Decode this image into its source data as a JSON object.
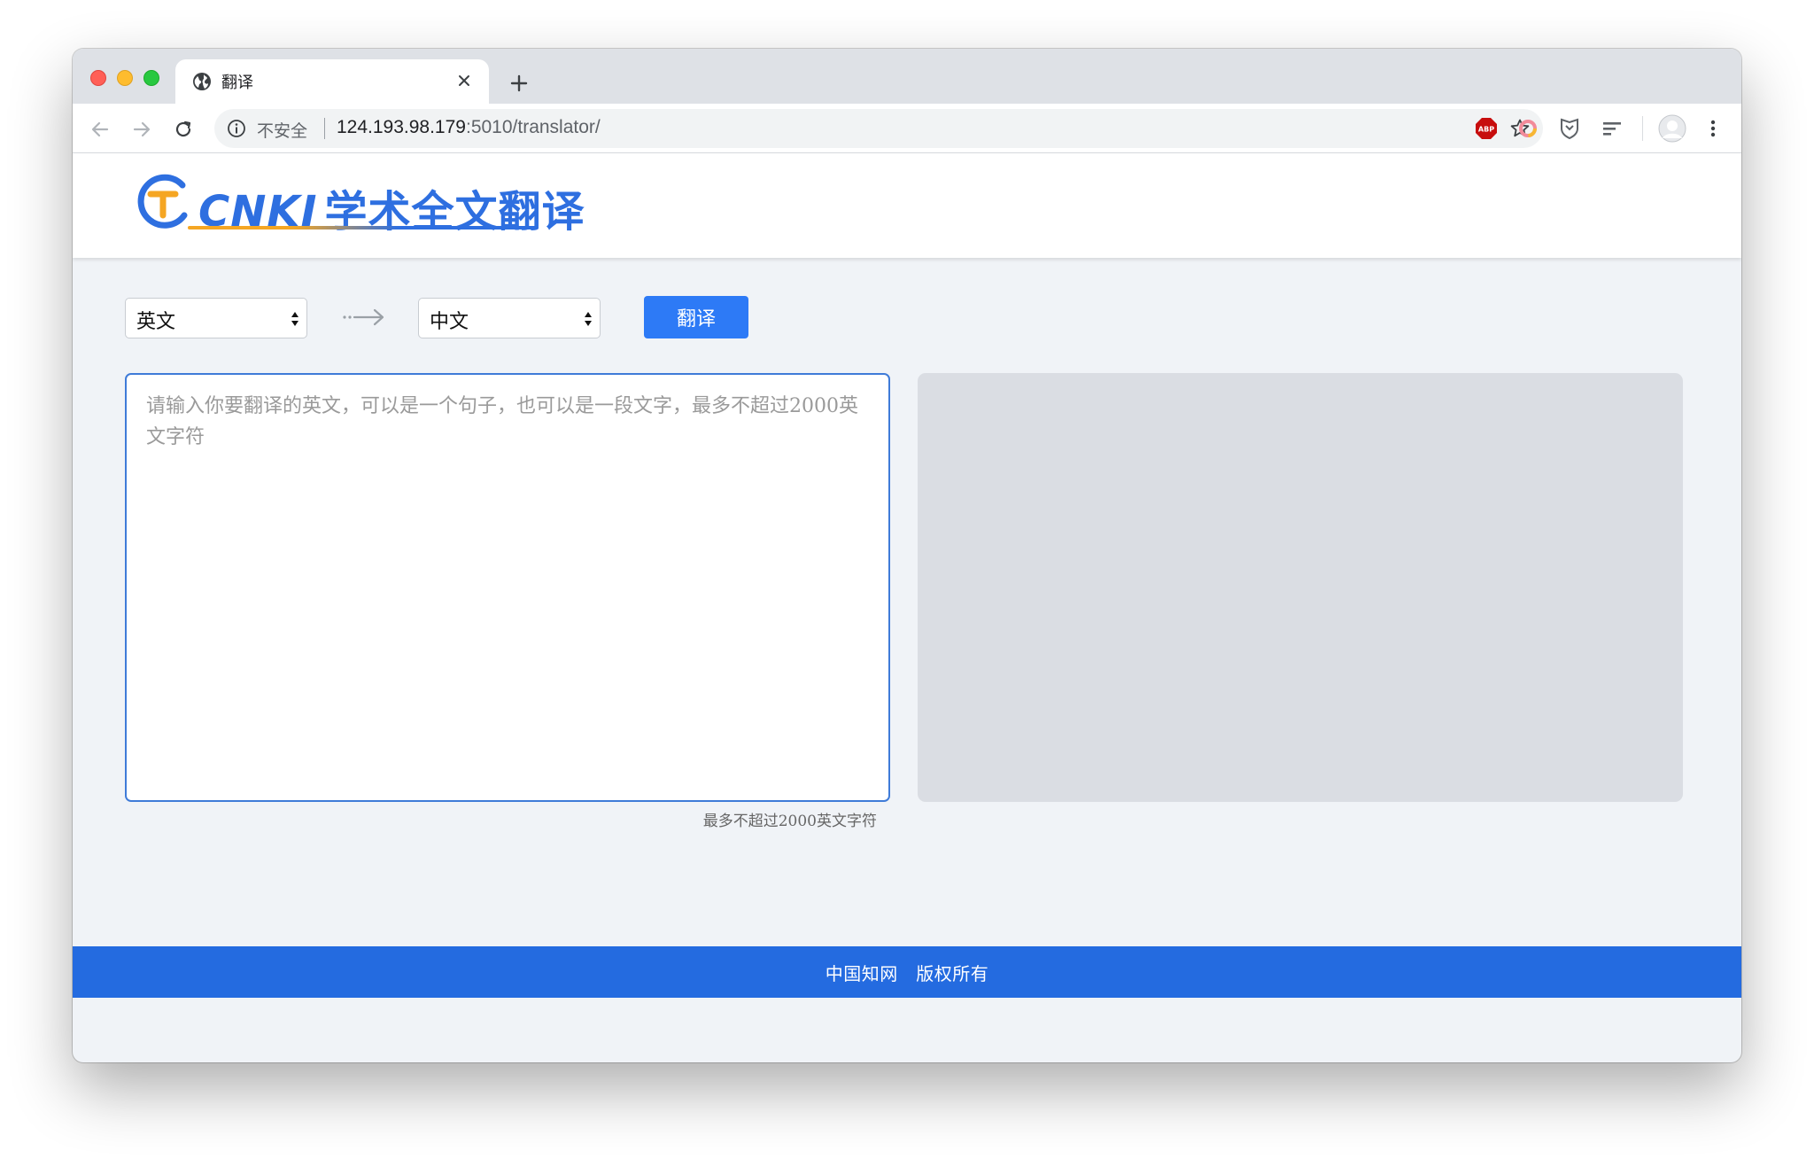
{
  "browser": {
    "tab": {
      "title": "翻译",
      "icon": "globe-icon"
    },
    "omnibox": {
      "security_label": "不安全",
      "url_host": "124.193.98.179",
      "url_path": ":5010/translator/"
    },
    "extensions": [
      "adblock-plus-icon",
      "ring-extension-icon",
      "shield-extension-icon",
      "list-extension-icon"
    ],
    "colors": {
      "tabstrip": "#dee1e6",
      "traffic_red": "#ff5f57",
      "traffic_yellow": "#febc2e",
      "traffic_green": "#28c840"
    }
  },
  "header": {
    "logo_brand": "CNKI",
    "logo_title": "学术全文翻译"
  },
  "controls": {
    "source_language": "英文",
    "target_language": "中文",
    "translate_label": "翻译"
  },
  "source_input": {
    "value": "",
    "placeholder": "请输入你要翻译的英文，可以是一个句子，也可以是一段文字，最多不超过2000英文字符"
  },
  "char_limit_note": "最多不超过2000英文字符",
  "result": {
    "value": ""
  },
  "footer": {
    "text": "中国知网　版权所有"
  },
  "colors": {
    "accent": "#2d7af6",
    "footer_bg": "#246be0",
    "page_bg": "#f0f3f7",
    "result_bg": "#dadde3",
    "input_border": "#3f7bd8"
  }
}
